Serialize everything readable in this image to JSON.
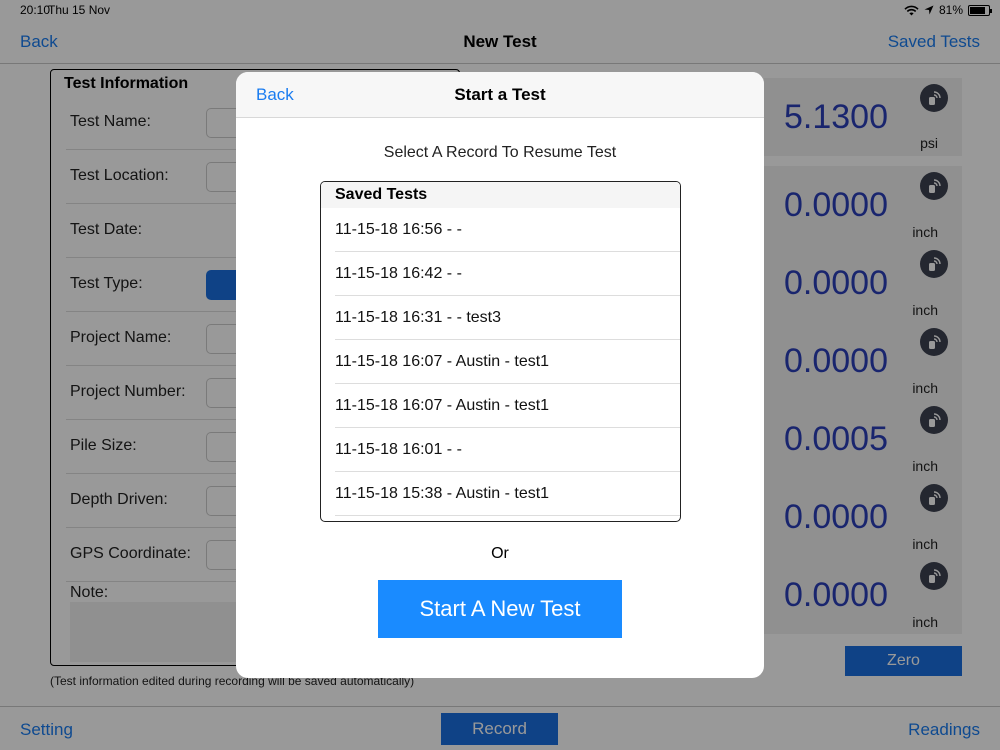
{
  "status_bar": {
    "time": "20:10",
    "date": "Thu 15 Nov",
    "battery": "81%"
  },
  "nav": {
    "back": "Back",
    "title": "New Test",
    "saved_tests": "Saved Tests"
  },
  "form": {
    "title": "Test Information",
    "fields": [
      {
        "label": "Test Name:"
      },
      {
        "label": "Test Location:"
      },
      {
        "label": "Test Date:"
      },
      {
        "label": "Test Type:"
      },
      {
        "label": "Project Name:"
      },
      {
        "label": "Project Number:"
      },
      {
        "label": "Pile Size:"
      },
      {
        "label": "Depth Driven:"
      },
      {
        "label": "GPS Coordinate:"
      }
    ],
    "note_label": "Note:",
    "footnote": "(Test information edited during recording will be saved automatically)"
  },
  "readings": [
    {
      "value": "5.1300",
      "unit": "psi"
    },
    {
      "value": "0.0000",
      "unit": "inch"
    },
    {
      "value": "0.0000",
      "unit": "inch"
    },
    {
      "value": "0.0000",
      "unit": "inch"
    },
    {
      "value": "0.0005",
      "unit": "inch"
    },
    {
      "value": "0.0000",
      "unit": "inch"
    },
    {
      "value": "0.0000",
      "unit": "inch"
    }
  ],
  "zero_label": "Zero",
  "toolbar": {
    "setting": "Setting",
    "record": "Record",
    "readings": "Readings"
  },
  "modal": {
    "back": "Back",
    "title": "Start a Test",
    "prompt": "Select A Record To Resume Test",
    "list_header": "Saved Tests",
    "items": [
      "11-15-18 16:56 -  -",
      "11-15-18 16:42 -  -",
      "11-15-18 16:31 -  - test3",
      "11-15-18 16:07 - Austin  - test1",
      "11-15-18 16:07 - Austin  - test1",
      "11-15-18 16:01 -  -",
      "11-15-18 15:38 - Austin  - test1"
    ],
    "or": "Or",
    "start_new": "Start A New Test"
  },
  "colors": {
    "accent": "#1a7cf0",
    "button": "#1a6fe0",
    "start_button": "#1a8bff",
    "reading_value": "#2b3fb8"
  }
}
